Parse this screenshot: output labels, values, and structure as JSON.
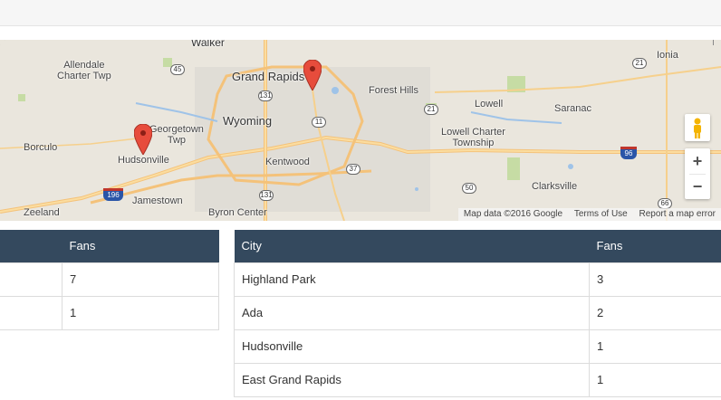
{
  "map": {
    "labels": {
      "walker": "Walker",
      "allendale": "Allendale\nCharter Twp",
      "grand_rapids": "Grand Rapids",
      "forest_hills": "Forest Hills",
      "ionia": "Ionia",
      "lowell": "Lowell",
      "saranac": "Saranac",
      "wyoming": "Wyoming",
      "georgetown": "Georgetown\nTwp",
      "borculo": "Borculo",
      "lowell_charter": "Lowell Charter\nTownship",
      "hudsonville": "Hudsonville",
      "kentwood": "Kentwood",
      "clarksville": "Clarksville",
      "jamestown": "Jamestown",
      "zeeland": "Zeeland",
      "byron_center": "Byron Center"
    },
    "shields": {
      "r45": "45",
      "r21a": "21",
      "r131a": "131",
      "r11": "11",
      "r21b": "21",
      "r37": "37",
      "r50": "50",
      "r131b": "131",
      "r66": "66"
    },
    "interstates": {
      "i96a": "96",
      "i196": "196"
    },
    "attribution": {
      "data": "Map data ©2016 Google",
      "terms": "Terms of Use",
      "report": "Report a map error"
    },
    "controls": {
      "zoom_in": "+",
      "zoom_out": "−"
    }
  },
  "left_table": {
    "headers": [
      "",
      "Fans"
    ],
    "rows": [
      [
        "",
        "7"
      ],
      [
        "",
        "1"
      ]
    ]
  },
  "right_table": {
    "headers": [
      "City",
      "Fans"
    ],
    "rows": [
      [
        "Highland Park",
        "3"
      ],
      [
        "Ada",
        "2"
      ],
      [
        "Hudsonville",
        "1"
      ],
      [
        "East Grand Rapids",
        "1"
      ]
    ]
  },
  "colors": {
    "header_bg": "#34495e",
    "pin": "#e74c3c"
  }
}
